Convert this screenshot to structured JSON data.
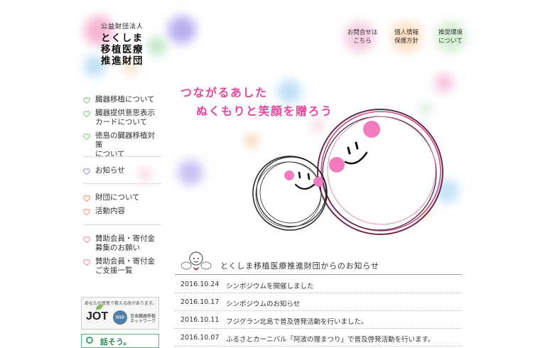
{
  "logo": {
    "subtitle": "公益財団法人",
    "line1": "とくしま",
    "line2": "移植医療",
    "line3": "推進財団"
  },
  "top_links": [
    {
      "label": "お問合せは\nこちら",
      "dot_color": "#f7b3d4"
    },
    {
      "label": "個人情報\n保護方針",
      "dot_color": "#ffd0a0"
    },
    {
      "label": "推奨環境\nについて",
      "dot_color": "#bfe8c0"
    }
  ],
  "nav": {
    "group1": [
      {
        "label": "臓器移植について"
      },
      {
        "label": "臓器提供意思表示\nカードについて"
      },
      {
        "label": "徳島の臓器移植対策\nについて"
      }
    ],
    "group2": [
      {
        "label": "お知らせ"
      }
    ],
    "group3": [
      {
        "label": "財団について"
      },
      {
        "label": "活動内容"
      }
    ],
    "group4": [
      {
        "label": "賛助会員・寄付金\n募集のお願い"
      },
      {
        "label": "賛助会員・寄付金\nご支援一覧"
      }
    ]
  },
  "heart_colors": {
    "green": "#8fcf8a",
    "gray": "#9aa6b8",
    "orange": "#f2a38a",
    "pink": "#f19ab5"
  },
  "hero": {
    "line1": "つながるあした",
    "line2": "ぬくもりと笑顔を贈ろう",
    "color": "#e5469e"
  },
  "news": {
    "title": "とくしま移植医療推進財団からのお知らせ",
    "items": [
      {
        "date": "2016.10.24",
        "title": "シンポジウムを開催しました"
      },
      {
        "date": "2016.10.17",
        "title": "シンポジウムのお知らせ"
      },
      {
        "date": "2016.10.11",
        "title": "フジグラン北島で普及啓発活動を行いました。"
      },
      {
        "date": "2016.10.07",
        "title": "ふるさとカーニバル「阿波の狸まつり」で普及啓発活動を行います。"
      }
    ]
  },
  "banners": {
    "jot_tagline": "あなたの意思で救える命があります。",
    "jot_logo": "JOT",
    "jot_nw": "NW",
    "jot_org": "日本臓器移植\nネットワーク",
    "talk_label": "話そう。"
  }
}
